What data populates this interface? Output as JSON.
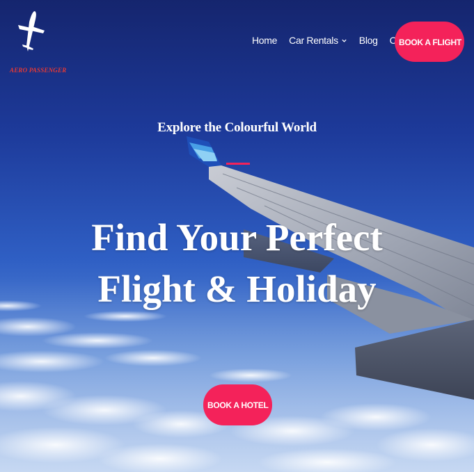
{
  "header": {
    "logo_text": "AERO PASSENGER",
    "nav": [
      {
        "label": "Home"
      },
      {
        "label": "Car Rentals"
      },
      {
        "label": "Blog"
      },
      {
        "label": "Contact"
      }
    ],
    "cta_label": "BOOK A FLIGHT"
  },
  "hero": {
    "kicker": "Explore the Colourful World",
    "title_line1": "Find Your Perfect",
    "title_line2": "Flight & Holiday",
    "cta_label": "BOOK A HOTEL"
  },
  "colors": {
    "accent": "#f4225a",
    "logo_red": "#e53935",
    "sky_top": "#15256e",
    "sky_bottom": "#98b8e8"
  },
  "icons": {
    "logo": "airplane-icon",
    "dropdown": "chevron-down-icon"
  }
}
